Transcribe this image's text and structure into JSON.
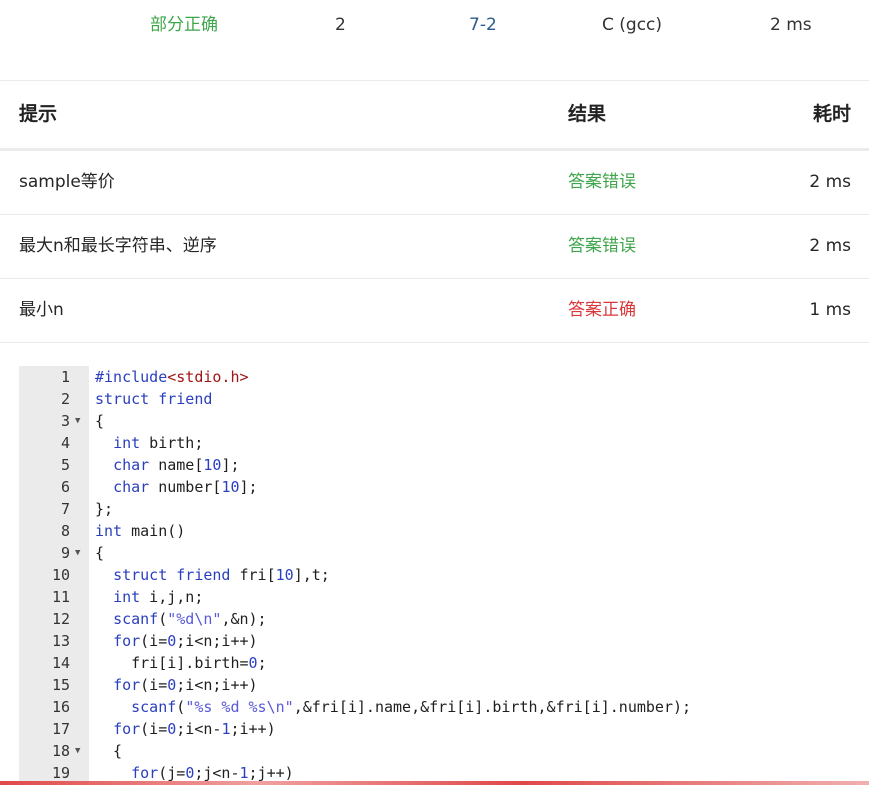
{
  "summary": {
    "status": "部分正确",
    "score": "2",
    "problem": "7-2",
    "language": "C (gcc)",
    "time": "2 ms"
  },
  "results_table": {
    "headers": {
      "hint": "提示",
      "result": "结果",
      "time": "耗时"
    },
    "rows": [
      {
        "hint": "sample等价",
        "result": "答案错误",
        "time": "2 ms",
        "result_color": "#3ea64a"
      },
      {
        "hint": "最大n和最长字符串、逆序",
        "result": "答案错误",
        "time": "2 ms",
        "result_color": "#3ea64a"
      },
      {
        "hint": "最小n",
        "result": "答案正确",
        "time": "1 ms",
        "result_color": "#d9383a"
      }
    ]
  },
  "code_editor": {
    "lines": [
      {
        "n": "1",
        "fold": false,
        "html": "<span style=\"color:#2a3fbf\">#include</span><span style=\"color:#a31515\">&lt;stdio.h&gt;</span>"
      },
      {
        "n": "2",
        "fold": false,
        "html": "<span style=\"color:#2a3fbf\">struct</span> <span style=\"color:#2a3fbf\">friend</span>"
      },
      {
        "n": "3",
        "fold": true,
        "html": "{"
      },
      {
        "n": "4",
        "fold": false,
        "html": "  <span style=\"color:#2a3fbf\">int</span> birth;"
      },
      {
        "n": "5",
        "fold": false,
        "html": "  <span style=\"color:#2a3fbf\">char</span> name[<span style=\"color:#2a3fbf\">10</span>];"
      },
      {
        "n": "6",
        "fold": false,
        "html": "  <span style=\"color:#2a3fbf\">char</span> number[<span style=\"color:#2a3fbf\">10</span>];"
      },
      {
        "n": "7",
        "fold": false,
        "html": "};"
      },
      {
        "n": "8",
        "fold": false,
        "html": "<span style=\"color:#2a3fbf\">int</span> main()"
      },
      {
        "n": "9",
        "fold": true,
        "html": "{"
      },
      {
        "n": "10",
        "fold": false,
        "html": "  <span style=\"color:#2a3fbf\">struct</span> <span style=\"color:#2a3fbf\">friend</span> fri[<span style=\"color:#2a3fbf\">10</span>],t;"
      },
      {
        "n": "11",
        "fold": false,
        "html": "  <span style=\"color:#2a3fbf\">int</span> i,j,n;"
      },
      {
        "n": "12",
        "fold": false,
        "html": "  <span style=\"color:#2a3fbf\">scanf</span>(<span style=\"color:#5a5ad8\">\"%d\\n\"</span>,&amp;n);"
      },
      {
        "n": "13",
        "fold": false,
        "html": "  <span style=\"color:#2a3fbf\">for</span>(i=<span style=\"color:#2a3fbf\">0</span>;i&lt;n;i++)"
      },
      {
        "n": "14",
        "fold": false,
        "html": "    fri[i].birth=<span style=\"color:#2a3fbf\">0</span>;"
      },
      {
        "n": "15",
        "fold": false,
        "html": "  <span style=\"color:#2a3fbf\">for</span>(i=<span style=\"color:#2a3fbf\">0</span>;i&lt;n;i++)"
      },
      {
        "n": "16",
        "fold": false,
        "html": "    <span style=\"color:#2a3fbf\">scanf</span>(<span style=\"color:#5a5ad8\">\"%s %d %s\\n\"</span>,&amp;fri[i].name,&amp;fri[i].birth,&amp;fri[i].number);"
      },
      {
        "n": "17",
        "fold": false,
        "html": "  <span style=\"color:#2a3fbf\">for</span>(i=<span style=\"color:#2a3fbf\">0</span>;i&lt;n-<span style=\"color:#2a3fbf\">1</span>;i++)"
      },
      {
        "n": "18",
        "fold": true,
        "html": "  {"
      },
      {
        "n": "19",
        "fold": false,
        "html": "    <span style=\"color:#2a3fbf\">for</span>(j=<span style=\"color:#2a3fbf\">0</span>;j&lt;n-<span style=\"color:#2a3fbf\">1</span>;j++)"
      }
    ]
  }
}
